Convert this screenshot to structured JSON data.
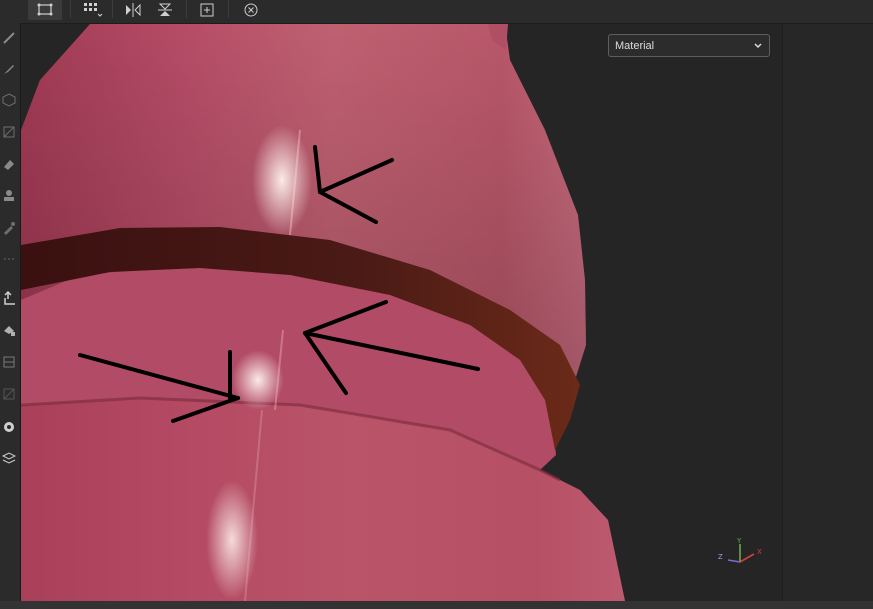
{
  "toolbar": {
    "buttons": [
      "select-vertices-icon",
      "grid-select-icon",
      "mirror-icon",
      "symmetry-icon",
      "frame-icon",
      "reset-icon"
    ]
  },
  "left_tools": [
    "brush-icon",
    "pen-icon",
    "cube-icon",
    "shading-icon",
    "eraser-icon",
    "stamp-icon",
    "eyedropper-icon",
    "export-icon",
    "material-tool-icon",
    "layers-icon",
    "mask-icon",
    "face-icon",
    "layers-stack-icon"
  ],
  "viewport": {
    "mode_dropdown": {
      "selected": "Material"
    },
    "gizmo": {
      "x_label": "X",
      "y_label": "Y",
      "z_label": "Z"
    }
  },
  "colors": {
    "mesh_base": "#b34a64",
    "ring": "#3f1414",
    "accent_x": "#d04040",
    "accent_y": "#6aa84f",
    "accent_z": "#7f6ad0"
  }
}
